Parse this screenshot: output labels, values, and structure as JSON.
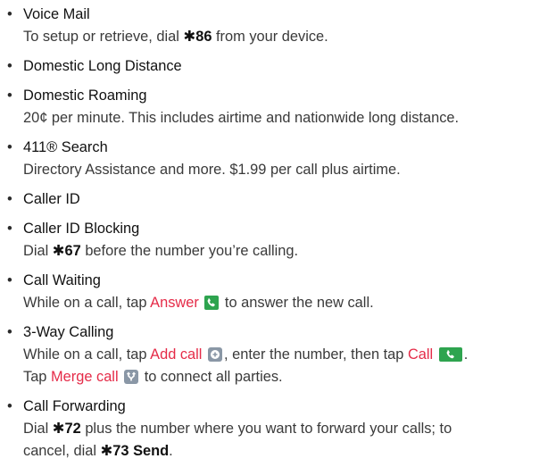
{
  "items": [
    {
      "title": "Voice Mail",
      "desc_pre": "To setup or retrieve, dial ",
      "code": "✱86",
      "desc_post": " from your device."
    },
    {
      "title": "Domestic Long Distance"
    },
    {
      "title": "Domestic Roaming",
      "desc": "20¢ per minute. This includes airtime and nationwide long distance."
    },
    {
      "title": "411® Search",
      "desc": "Directory Assistance and more. $1.99 per call plus airtime."
    },
    {
      "title": "Caller ID"
    },
    {
      "title": "Caller ID Blocking",
      "desc_pre": "Dial ",
      "code": "✱67",
      "desc_post": " before the number you’re calling."
    },
    {
      "title": "Call Waiting",
      "desc_pre": "While on a call, tap ",
      "action": "Answer",
      "desc_post": " to answer the new call."
    },
    {
      "title": "3-Way Calling",
      "line1_pre": "While on a call, tap ",
      "action1": "Add call",
      "line1_mid": ", enter the number, then tap ",
      "action2": "Call",
      "line1_post": ".",
      "line2_pre": "Tap ",
      "action3": "Merge call",
      "line2_post": " to connect all parties."
    },
    {
      "title": "Call Forwarding",
      "line1_pre": "Dial ",
      "code1": "✱72",
      "line1_post": " plus the number where you want to forward your calls; to",
      "line2_pre": "cancel, dial ",
      "code2": "✱73 Send",
      "line2_post": "."
    }
  ],
  "bullet": "•",
  "colors": {
    "action": "#e52b48",
    "call_icon": "#2ea44f",
    "add_icon": "#8a97a6"
  },
  "icons": [
    "phone-answer-icon",
    "add-call-icon",
    "call-icon",
    "merge-call-icon"
  ]
}
